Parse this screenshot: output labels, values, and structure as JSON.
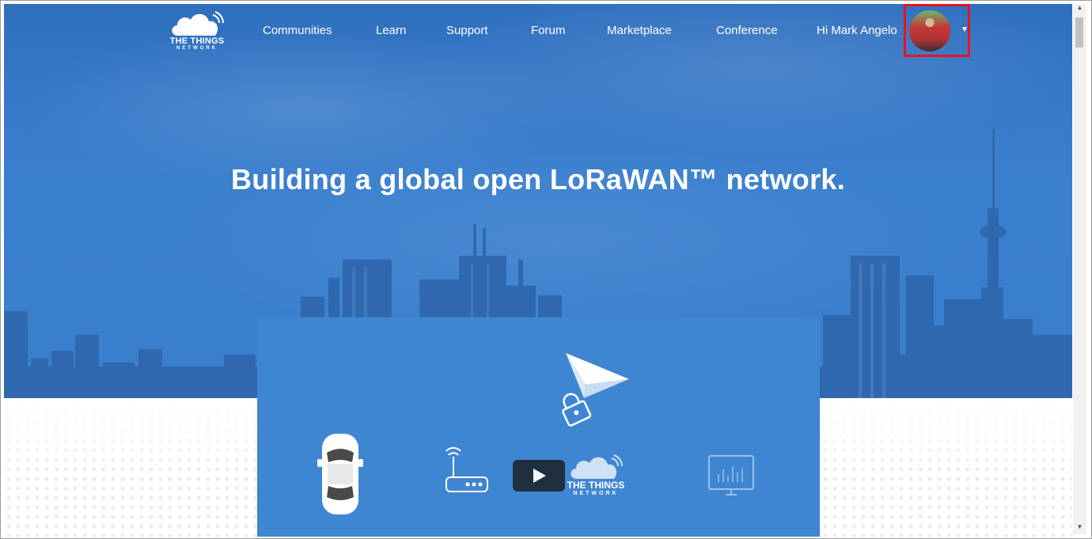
{
  "brand": {
    "logo_line1": "THE THINGS",
    "logo_line2": "NETWORK"
  },
  "nav": {
    "items": [
      {
        "label": "Communities"
      },
      {
        "label": "Learn"
      },
      {
        "label": "Support"
      },
      {
        "label": "Forum"
      },
      {
        "label": "Marketplace"
      },
      {
        "label": "Conference"
      }
    ],
    "greeting": "Hi Mark Angelo"
  },
  "hero": {
    "headline": "Building a global open LoRaWAN™ network."
  },
  "video": {
    "logo_line1": "THE THINGS",
    "logo_line2": "NETWORK"
  },
  "icons": {
    "avatar": "user-avatar-icon",
    "caret": "chevron-down-icon",
    "play": "play-icon",
    "car": "car-icon",
    "gateway": "gateway-router-icon",
    "paper_plane": "paper-plane-icon",
    "lock": "lock-icon",
    "dashboard": "dashboard-chart-icon"
  },
  "colors": {
    "hero_blue": "#3b80cf",
    "video_panel": "#3f86d2",
    "highlight_red": "#e8131f",
    "play_button": "#1f2b36"
  }
}
